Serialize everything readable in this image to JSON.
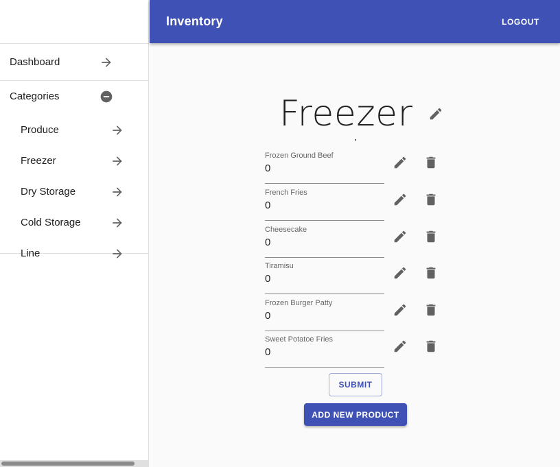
{
  "app": {
    "title": "Inventory",
    "logout_label": "LOGOUT"
  },
  "sidebar": {
    "dashboard_label": "Dashboard",
    "categories_label": "Categories",
    "categories": [
      {
        "label": "Produce"
      },
      {
        "label": "Freezer"
      },
      {
        "label": "Dry Storage"
      },
      {
        "label": "Cold Storage"
      },
      {
        "label": "Line"
      }
    ]
  },
  "page": {
    "title": "Freezer"
  },
  "products": [
    {
      "name": "Frozen Ground Beef",
      "quantity": "0"
    },
    {
      "name": "French Fries",
      "quantity": "0"
    },
    {
      "name": "Cheesecake",
      "quantity": "0"
    },
    {
      "name": "Tiramisu",
      "quantity": "0"
    },
    {
      "name": "Frozen Burger Patty",
      "quantity": "0"
    },
    {
      "name": "Sweet Potatoe Fries",
      "quantity": "0"
    }
  ],
  "actions": {
    "submit_label": "SUBMIT",
    "add_label": "ADD NEW PRODUCT"
  },
  "colors": {
    "primary": "#3f51b5",
    "icon": "#616161"
  },
  "icons": {
    "nav": "arrow-right-icon",
    "collapse": "minus-circle-icon",
    "edit": "pencil-icon",
    "delete": "trash-icon"
  }
}
